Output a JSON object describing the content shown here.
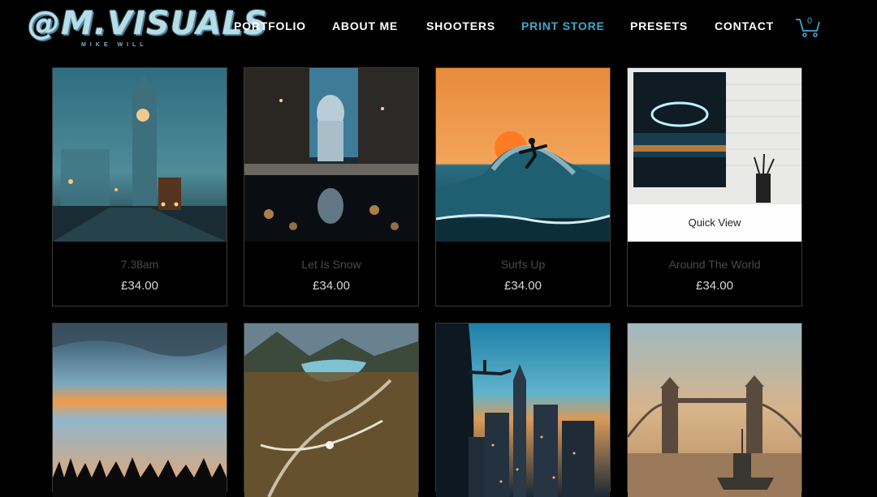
{
  "brand": {
    "logo_text": "@M.VISUALS",
    "tagline": "MIKE WILL"
  },
  "nav": {
    "items": [
      {
        "label": "PORTFOLIO"
      },
      {
        "label": "ABOUT ME"
      },
      {
        "label": "SHOOTERS"
      },
      {
        "label": "PRINT STORE",
        "active": true
      },
      {
        "label": "PRESETS"
      },
      {
        "label": "CONTACT"
      }
    ],
    "cart_count": "0",
    "active_color": "#3fa9c9"
  },
  "products": [
    {
      "title": "7.38am",
      "price": "£34.00",
      "image": "foggy-london-big-ben-bus"
    },
    {
      "title": "Let Is Snow",
      "price": "£34.00",
      "image": "st-pauls-reflection-night"
    },
    {
      "title": "Surfs Up",
      "price": "£34.00",
      "image": "surfer-sunset-wave"
    },
    {
      "title": "Around The World",
      "price": "£34.00",
      "image": "neon-hoop-frame-mockup",
      "quick_view": "Quick View"
    },
    {
      "title": "",
      "price": "",
      "image": "sunset-treeline-sky"
    },
    {
      "title": "",
      "price": "",
      "image": "highland-viaduct-aerial"
    },
    {
      "title": "",
      "price": "",
      "image": "helicopter-nyc-skyline"
    },
    {
      "title": "",
      "price": "",
      "image": "tower-bridge-warship-mist"
    }
  ]
}
